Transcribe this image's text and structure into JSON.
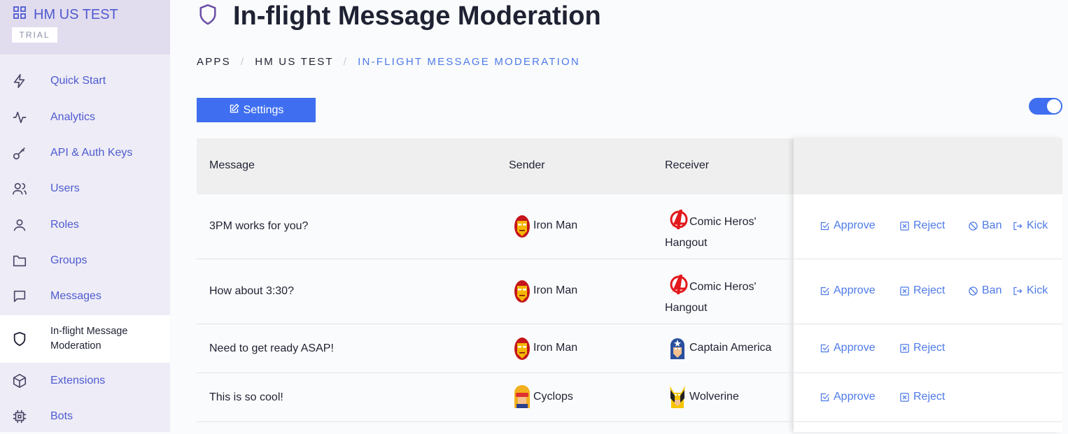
{
  "app": {
    "name": "HM US TEST",
    "badge": "TRIAL"
  },
  "nav": [
    {
      "label": "Quick Start",
      "icon": "lightning-icon"
    },
    {
      "label": "Analytics",
      "icon": "activity-icon"
    },
    {
      "label": "API & Auth Keys",
      "icon": "key-icon"
    },
    {
      "label": "Users",
      "icon": "users-icon"
    },
    {
      "label": "Roles",
      "icon": "user-icon"
    },
    {
      "label": "Groups",
      "icon": "folder-icon"
    },
    {
      "label": "Messages",
      "icon": "message-icon"
    },
    {
      "label": "In-flight Message Moderation",
      "icon": "shield-icon",
      "active": true
    },
    {
      "label": "Extensions",
      "icon": "cube-icon"
    },
    {
      "label": "Bots",
      "icon": "chip-icon"
    }
  ],
  "page": {
    "title": "In-flight Message Moderation"
  },
  "breadcrumb": [
    "APPS",
    "HM US TEST",
    "IN-FLIGHT MESSAGE MODERATION"
  ],
  "settings_label": "Settings",
  "table": {
    "headers": {
      "message": "Message",
      "sender": "Sender",
      "receiver": "Receiver"
    },
    "rows": [
      {
        "message": "3PM works for you?",
        "sender": "Iron Man",
        "receiver": "Comic Heros' Hangout",
        "actions": [
          "Approve",
          "Reject",
          "Ban",
          "Kick"
        ]
      },
      {
        "message": "How about 3:30?",
        "sender": "Iron Man",
        "receiver": "Comic Heros' Hangout",
        "actions": [
          "Approve",
          "Reject",
          "Ban",
          "Kick"
        ]
      },
      {
        "message": "Need to get ready ASAP!",
        "sender": "Iron Man",
        "receiver": "Captain America",
        "actions": [
          "Approve",
          "Reject"
        ]
      },
      {
        "message": "This is so cool!",
        "sender": "Cyclops",
        "receiver": "Wolverine",
        "actions": [
          "Approve",
          "Reject"
        ]
      }
    ]
  },
  "colors": {
    "accent": "#3f6ff0",
    "link": "#4e7ae8",
    "sidebar": "#eeecf6"
  }
}
